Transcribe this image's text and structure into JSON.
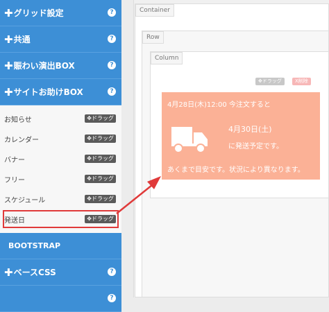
{
  "sidebar": {
    "sections": [
      {
        "label": "グリッド設定",
        "help": "?"
      },
      {
        "label": "共通",
        "help": "?"
      },
      {
        "label": "賑わい演出BOX",
        "help": "?"
      },
      {
        "label": "サイトお助けBOX",
        "help": "?"
      }
    ],
    "items": [
      {
        "label": "お知らせ",
        "drag": "ドラッグ"
      },
      {
        "label": "カレンダー",
        "drag": "ドラッグ"
      },
      {
        "label": "バナー",
        "drag": "ドラッグ"
      },
      {
        "label": "フリー",
        "drag": "ドラッグ"
      },
      {
        "label": "スケジュール",
        "drag": "ドラッグ"
      },
      {
        "label": "発送日",
        "drag": "ドラッグ"
      }
    ],
    "bootstrap_label": "BOOTSTRAP",
    "base_css_label": "ベースCSS",
    "base_css_help": "?"
  },
  "editor": {
    "container_label": "Container",
    "row_label": "Row",
    "column_label": "Column",
    "drag_label": "ドラッグ",
    "delete_label": "X削除",
    "shipping": {
      "line1": "4月28日(木)12:00 今注文すると",
      "date": "4月30日(土)",
      "line2": "に発送予定です。",
      "note": "あくまで目安です。状況により異なります。"
    }
  },
  "colors": {
    "sidebar_header": "#3d8fd6",
    "highlight": "#e03a3a",
    "orange_box": "#fbb196"
  }
}
